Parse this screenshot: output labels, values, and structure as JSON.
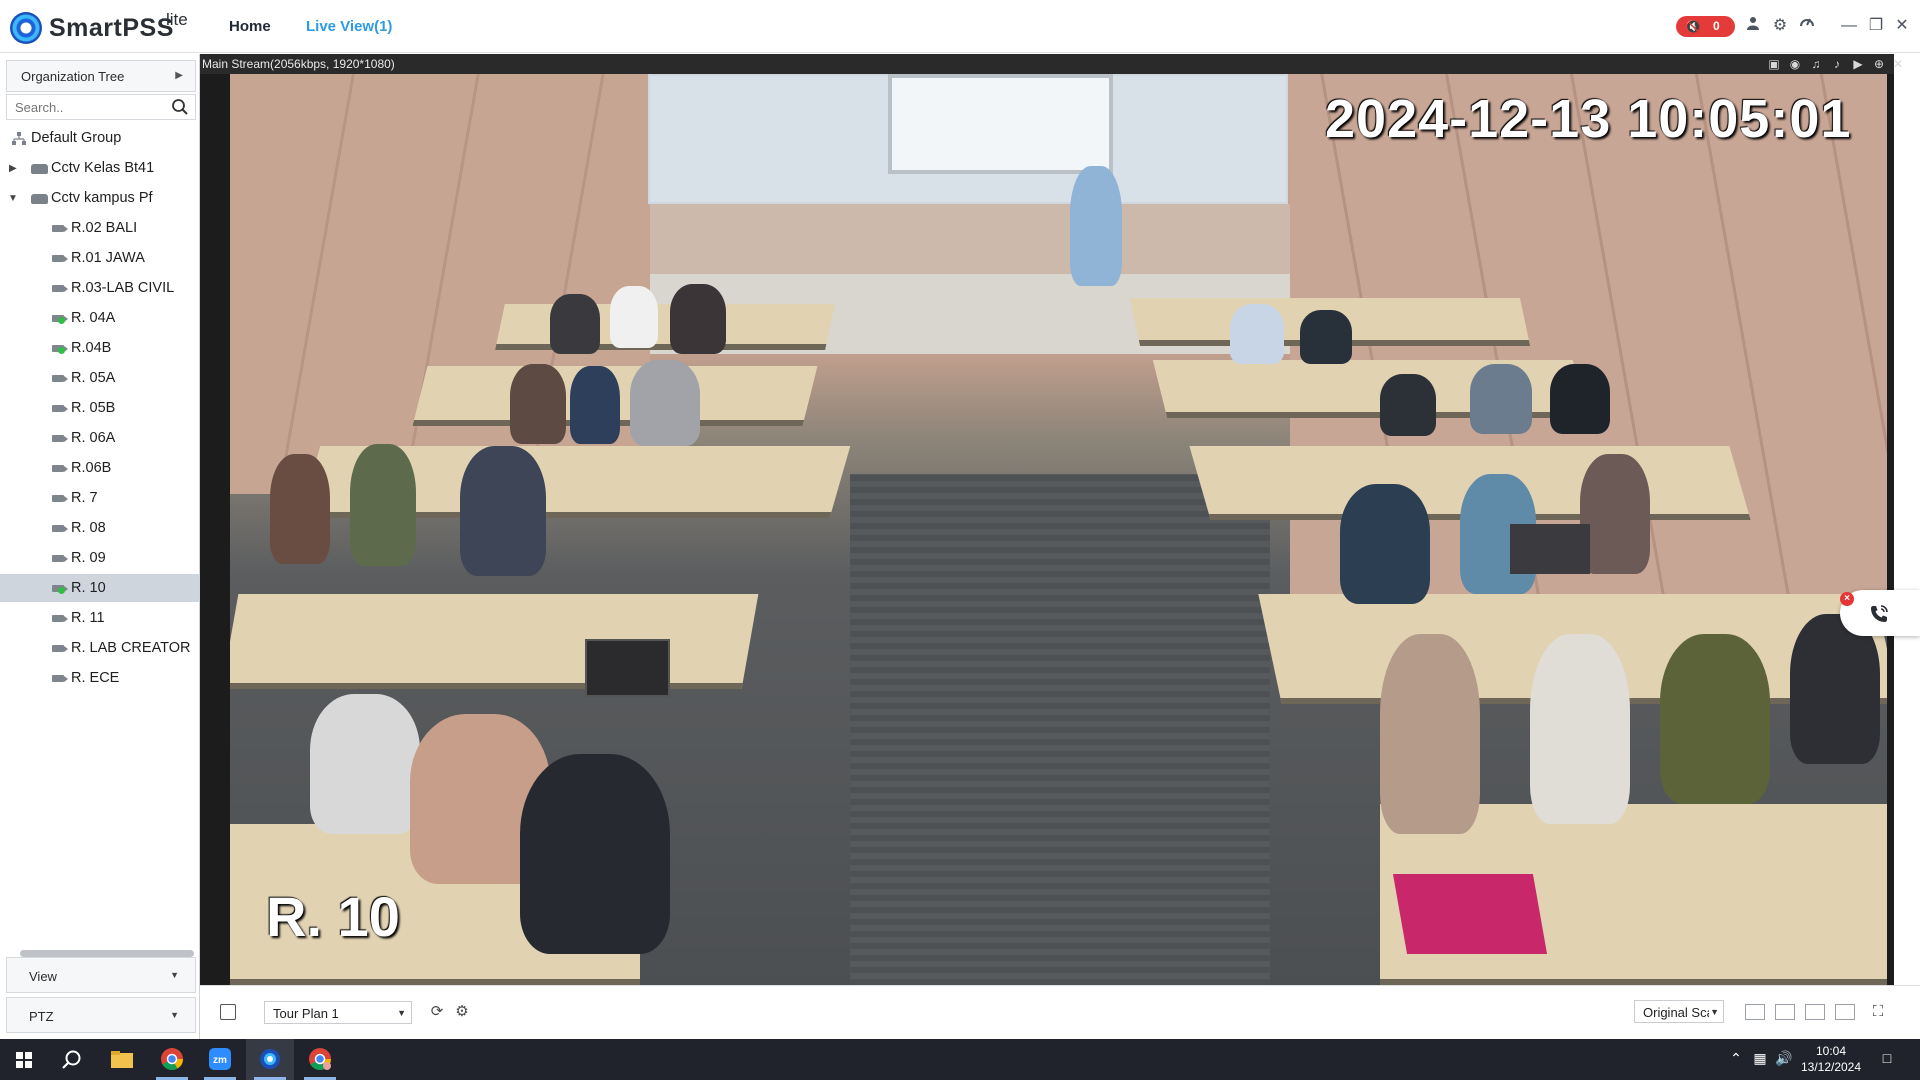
{
  "app": {
    "brand": "SmartPSS",
    "brand_suffix": "lite",
    "tabs": [
      {
        "label": "Home",
        "active": false
      },
      {
        "label": "Live View(1)",
        "active": true
      }
    ],
    "alarm_count": "0",
    "accent_color": "#2f9be5",
    "alarm_color": "#e53a3a"
  },
  "sidebar": {
    "org_tree_label": "Organization Tree",
    "search_placeholder": "Search..",
    "root_group": "Default Group",
    "devices": [
      {
        "label": "Cctv Kelas Bt41",
        "expanded": false
      },
      {
        "label": "Cctv kampus Pf",
        "expanded": true
      }
    ],
    "channels": [
      {
        "label": "R.02 BALI",
        "online": false
      },
      {
        "label": "R.01 JAWA",
        "online": false
      },
      {
        "label": "R.03-LAB CIVIL",
        "online": false
      },
      {
        "label": "R. 04A",
        "online": true
      },
      {
        "label": "R.04B",
        "online": true
      },
      {
        "label": "R. 05A",
        "online": false
      },
      {
        "label": "R. 05B",
        "online": false
      },
      {
        "label": "R. 06A",
        "online": false
      },
      {
        "label": "R.06B",
        "online": false
      },
      {
        "label": "R. 7",
        "online": false
      },
      {
        "label": "R. 08",
        "online": false
      },
      {
        "label": "R. 09",
        "online": false
      },
      {
        "label": "R. 10",
        "online": true,
        "selected": true
      },
      {
        "label": "R. 11",
        "online": false
      },
      {
        "label": "R. LAB CREATOR",
        "online": false
      },
      {
        "label": "R. ECE",
        "online": false
      }
    ],
    "view_label": "View",
    "ptz_label": "PTZ"
  },
  "video": {
    "stream_info": "Main Stream(2056kbps, 1920*1080)",
    "osd_timestamp": "2024-12-13  10:05:01",
    "osd_channel": "R. 10",
    "tool_icons": [
      "window-icon",
      "snapshot-icon",
      "audio-icon",
      "mic-icon",
      "record-icon",
      "zoom-icon",
      "close-icon"
    ]
  },
  "bottom": {
    "tour_plan": "Tour Plan 1",
    "scale": "Original Scale"
  },
  "taskbar": {
    "time": "10:04",
    "date": "13/12/2024",
    "apps": [
      "windows-start-icon",
      "search-icon",
      "file-explorer-icon",
      "chrome-icon",
      "zoom-app-icon",
      "smartpss-icon",
      "chrome-icon"
    ]
  }
}
